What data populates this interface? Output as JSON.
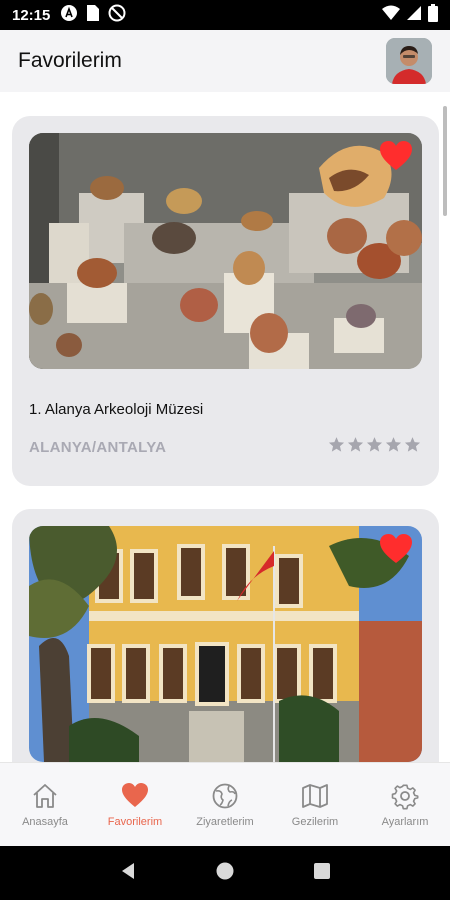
{
  "status_bar": {
    "time": "12:15",
    "icons": [
      "a-circle-icon",
      "sim-icon",
      "no-disturb-icon",
      "wifi-icon",
      "signal-icon",
      "battery-icon"
    ]
  },
  "header": {
    "title": "Favorilerim"
  },
  "favorites": [
    {
      "title": "1. Alanya Arkeoloji Müzesi",
      "location": "ALANYA/ANTALYA",
      "favorited": true,
      "rating_stars": 5
    },
    {
      "title": "",
      "location": "",
      "favorited": true
    }
  ],
  "bottom_nav": {
    "items": [
      {
        "label": "Anasayfa",
        "icon": "home-icon",
        "active": false
      },
      {
        "label": "Favorilerim",
        "icon": "heart-icon",
        "active": true
      },
      {
        "label": "Ziyaretlerim",
        "icon": "globe-icon",
        "active": false
      },
      {
        "label": "Gezilerim",
        "icon": "map-icon",
        "active": false
      },
      {
        "label": "Ayarlarım",
        "icon": "gear-icon",
        "active": false
      }
    ]
  },
  "colors": {
    "accent": "#e9664d",
    "heart": "#ff2d2d",
    "inactive": "#8a8a8a",
    "card_bg": "#e9e9ec",
    "location_text": "#a9a9b3"
  }
}
